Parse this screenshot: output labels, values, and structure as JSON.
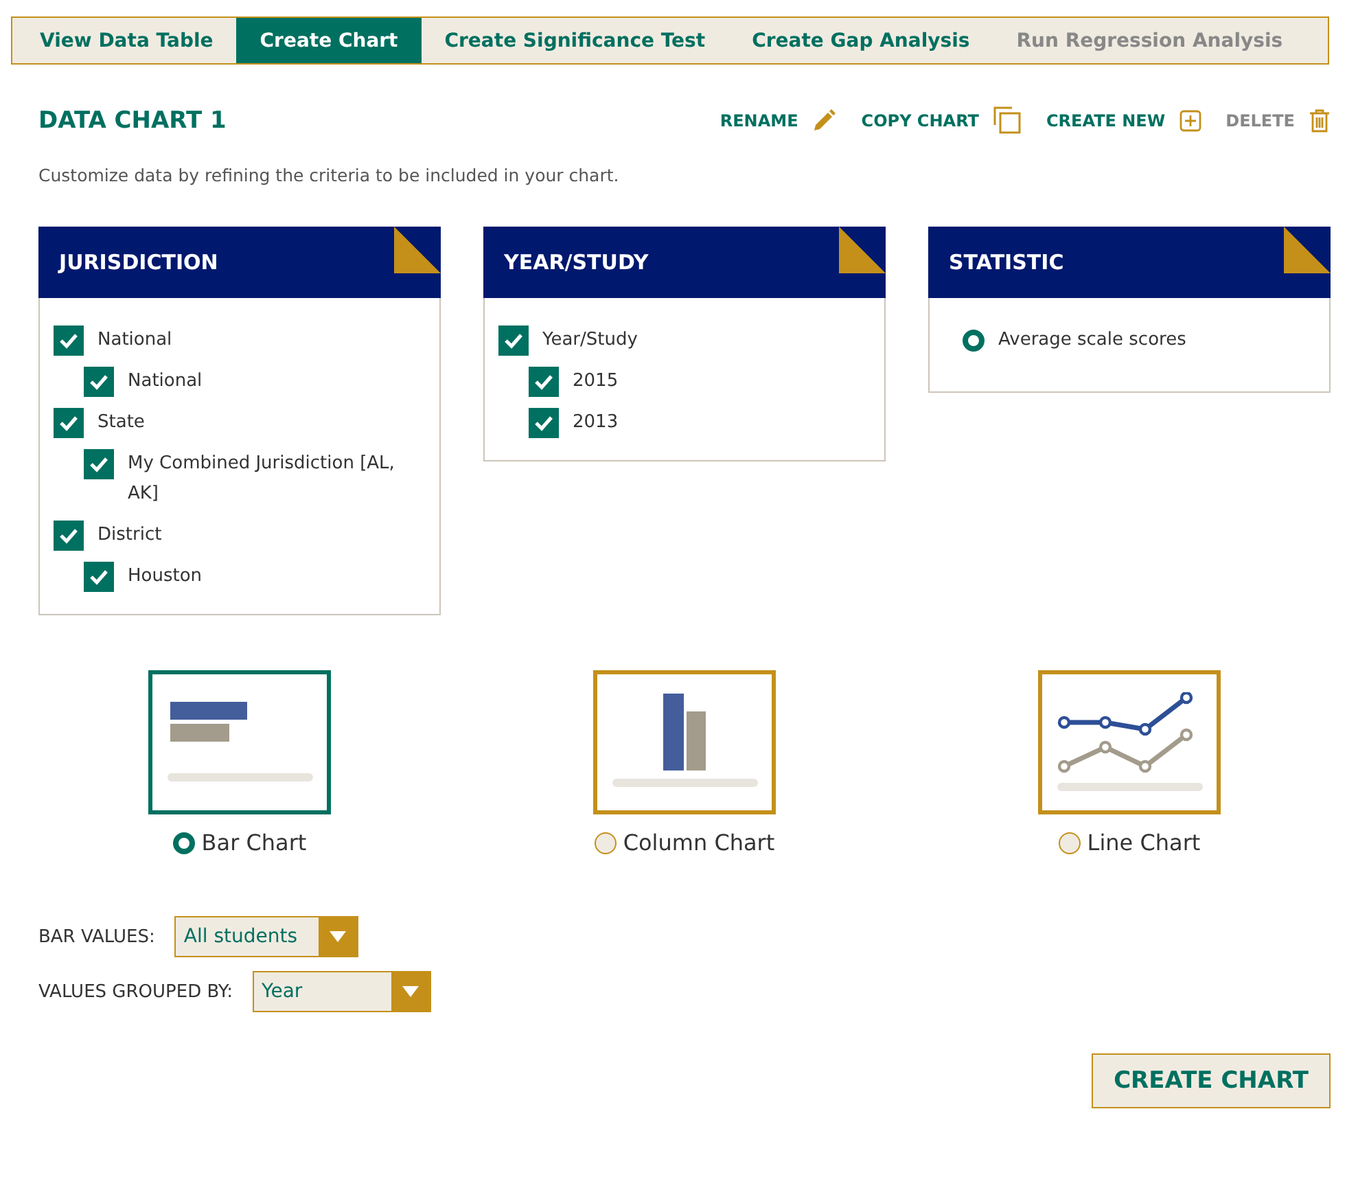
{
  "tabs": [
    {
      "label": "View Data Table",
      "selected": false,
      "disabled": false
    },
    {
      "label": "Create Chart",
      "selected": true,
      "disabled": false
    },
    {
      "label": "Create Significance Test",
      "selected": false,
      "disabled": false
    },
    {
      "label": "Create Gap Analysis",
      "selected": false,
      "disabled": false
    },
    {
      "label": "Run Regression Analysis",
      "selected": false,
      "disabled": true
    }
  ],
  "title": "DATA CHART 1",
  "actions": [
    {
      "label": "RENAME",
      "kind": "pencil",
      "disabled": false
    },
    {
      "label": "COPY CHART",
      "kind": "copy",
      "disabled": false
    },
    {
      "label": "CREATE NEW",
      "kind": "plus",
      "disabled": false
    },
    {
      "label": "DELETE",
      "kind": "trash",
      "disabled": true
    }
  ],
  "description": "Customize data by refining the criteria to be included in your chart.",
  "panels": [
    {
      "title": "JURISDICTION",
      "kind": "checkbox",
      "items": [
        {
          "label": "National",
          "checked": true,
          "children": [
            {
              "label": "National",
              "checked": true
            }
          ]
        },
        {
          "label": "State",
          "checked": true,
          "children": [
            {
              "label": "My Combined Jurisdiction [AL, AK]",
              "checked": true
            }
          ]
        },
        {
          "label": "District",
          "checked": true,
          "children": [
            {
              "label": "Houston",
              "checked": true
            }
          ]
        }
      ]
    },
    {
      "title": "YEAR/STUDY",
      "kind": "checkbox",
      "items": [
        {
          "label": "Year/Study",
          "checked": true,
          "children": [
            {
              "label": "2015",
              "checked": true
            },
            {
              "label": "2013",
              "checked": true
            }
          ]
        }
      ]
    },
    {
      "title": "STATISTIC",
      "kind": "radio",
      "items": [
        {
          "label": "Average scale scores",
          "checked": true
        }
      ]
    }
  ],
  "chart_types": [
    {
      "label": "Bar Chart",
      "kind": "bar",
      "selected": true
    },
    {
      "label": "Column Chart",
      "kind": "column",
      "selected": false
    },
    {
      "label": "Line Chart",
      "kind": "line",
      "selected": false
    }
  ],
  "dropdowns": [
    {
      "label": "BAR VALUES:",
      "value": "All students"
    },
    {
      "label": "VALUES GROUPED BY:",
      "value": "Year"
    }
  ],
  "submit": "CREATE CHART"
}
